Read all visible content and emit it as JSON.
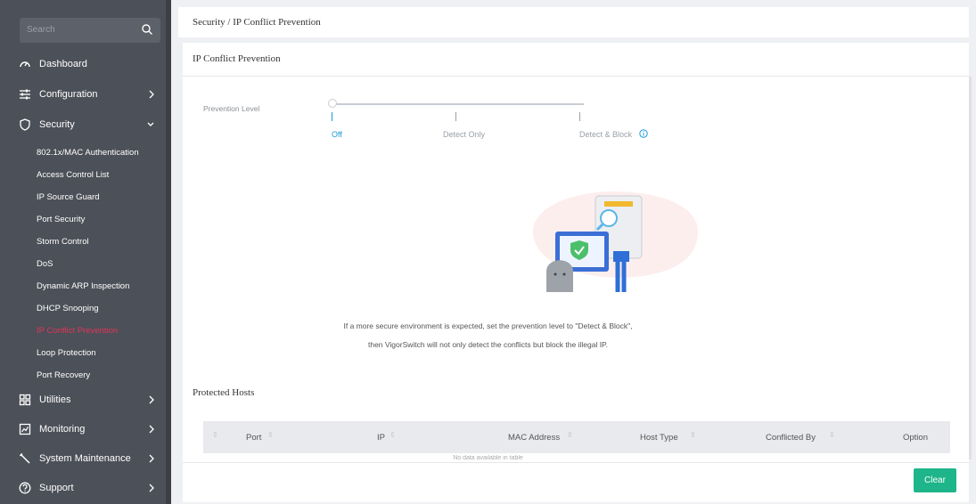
{
  "sidebar": {
    "search_placeholder": "Search",
    "items": [
      {
        "label": "Dashboard",
        "icon": "dashboard-icon"
      },
      {
        "label": "Configuration",
        "icon": "sliders-icon"
      },
      {
        "label": "Security",
        "icon": "shield-icon"
      },
      {
        "label": "Utilities",
        "icon": "grid-icon"
      },
      {
        "label": "Monitoring",
        "icon": "chart-icon"
      },
      {
        "label": "System Maintenance",
        "icon": "wrench-icon"
      },
      {
        "label": "Support",
        "icon": "question-icon"
      }
    ],
    "security_sub": [
      "802.1x/MAC Authentication",
      "Access Control List",
      "IP Source Guard",
      "Port Security",
      "Storm Control",
      "DoS",
      "Dynamic ARP Inspection",
      "DHCP Snooping",
      "IP Conflict Prevention",
      "Loop Protection",
      "Port Recovery"
    ]
  },
  "breadcrumb": "Security / IP Conflict Prevention",
  "panel": {
    "title": "IP Conflict Prevention",
    "prevention_label": "Prevention Level",
    "levels": [
      "Off",
      "Detect Only",
      "Detect & Block"
    ],
    "selected_level": "Off",
    "desc_line1": "If a more secure environment is expected, set the prevention level to \"Detect & Block\",",
    "desc_line2": "then VigorSwitch will not only detect the conflicts but block the illegal IP.",
    "protected_title": "Protected Hosts",
    "columns": [
      "Port",
      "IP",
      "MAC Address",
      "Host Type",
      "Conflicted By",
      "Option"
    ],
    "no_data": "No data available in table",
    "clear_label": "Clear"
  },
  "colors": {
    "accent": "#1e9ad6",
    "active_menu": "#e0355a",
    "button": "#1fb58a",
    "sidebar": "#4c5058"
  }
}
